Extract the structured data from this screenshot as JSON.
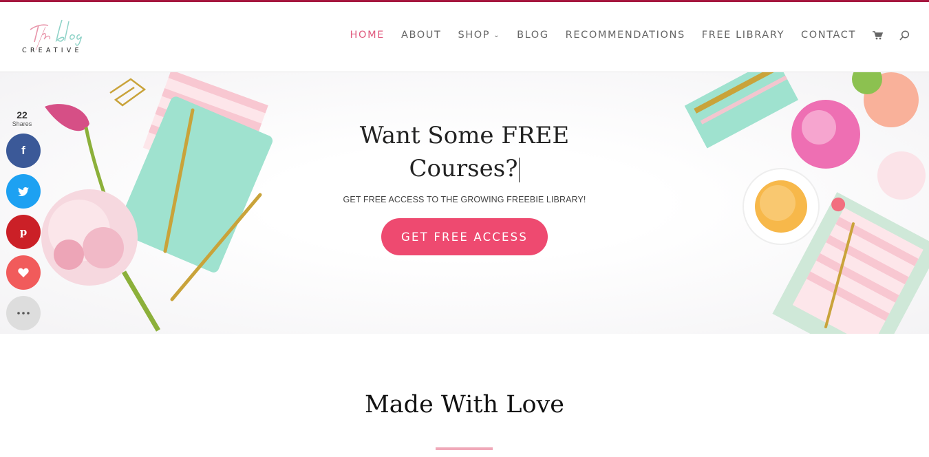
{
  "brand": {
    "logo_script": "The Blog",
    "logo_word": "CREATIVE",
    "accent_color": "#ee4a70",
    "top_strip_color": "#a6173f"
  },
  "nav": {
    "items": [
      {
        "label": "HOME",
        "active": true
      },
      {
        "label": "ABOUT"
      },
      {
        "label": "SHOP",
        "has_dropdown": true
      },
      {
        "label": "BLOG"
      },
      {
        "label": "RECOMMENDATIONS"
      },
      {
        "label": "FREE LIBRARY"
      },
      {
        "label": "CONTACT"
      }
    ],
    "cart_icon": "cart-icon",
    "search_icon": "search-icon"
  },
  "hero": {
    "title_line1": "Want Some FREE",
    "title_line2": "Courses?",
    "subtitle": "GET FREE ACCESS TO THE GROWING FREEBIE LIBRARY!",
    "cta_label": "GET FREE ACCESS"
  },
  "share": {
    "count": "22",
    "label": "Shares",
    "buttons": [
      {
        "network": "facebook",
        "glyph": "f",
        "color": "#3b5998"
      },
      {
        "network": "twitter",
        "glyph": "t",
        "color": "#1da1f2"
      },
      {
        "network": "pinterest",
        "glyph": "p",
        "color": "#cb2027"
      },
      {
        "network": "love",
        "glyph": "heart",
        "color": "#f15b5b"
      },
      {
        "network": "more",
        "glyph": "more",
        "color": "#dddddd"
      }
    ]
  },
  "section": {
    "title": "Made With Love"
  }
}
